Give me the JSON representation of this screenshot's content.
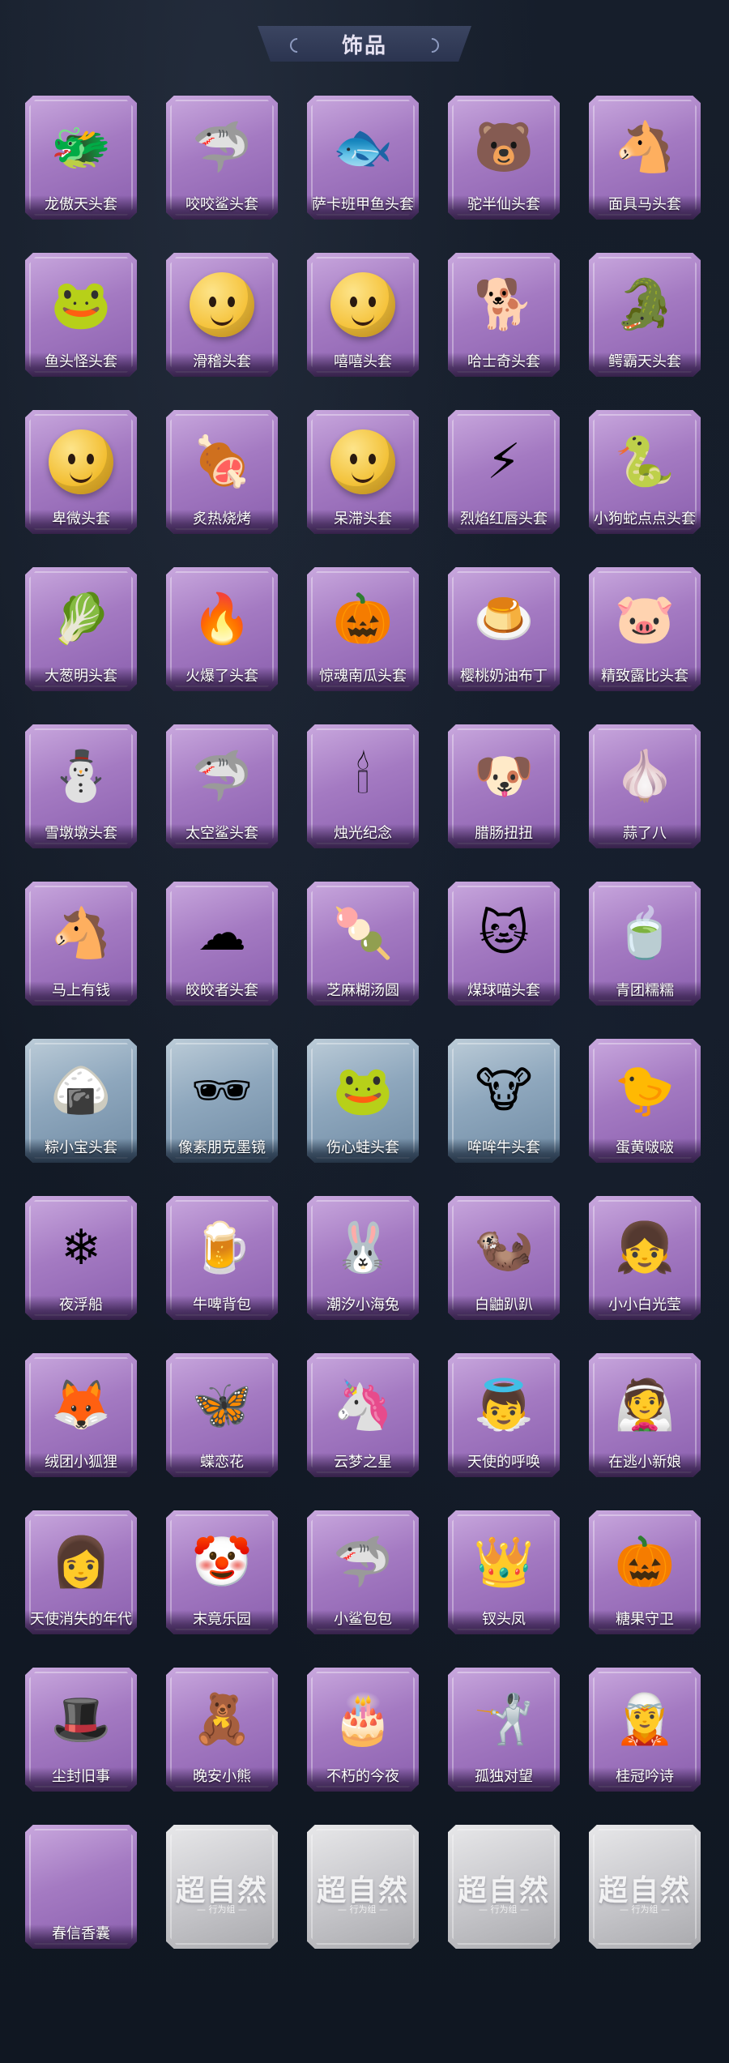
{
  "header": {
    "title": "饰品"
  },
  "items": [
    {
      "label": "龙傲天头套",
      "icon": "dragon-mask",
      "glyph": "🐲",
      "style": "purple"
    },
    {
      "label": "咬咬鲨头套",
      "icon": "shark-mask",
      "glyph": "🦈",
      "style": "purple"
    },
    {
      "label": "萨卡班甲鱼头套",
      "icon": "fish-mask",
      "glyph": "🐟",
      "style": "purple"
    },
    {
      "label": "驼半仙头套",
      "icon": "bear-sunglasses-mask",
      "glyph": "🐻",
      "style": "purple"
    },
    {
      "label": "面具马头套",
      "icon": "horse-mask",
      "glyph": "🐴",
      "style": "purple"
    },
    {
      "label": "鱼头怪头套",
      "icon": "fish-head-mask",
      "glyph": "🐸",
      "style": "purple"
    },
    {
      "label": "滑稽头套",
      "icon": "smirk-face-mask",
      "glyph": "",
      "ball": "#f5c23a",
      "style": "purple"
    },
    {
      "label": "嘻嘻头套",
      "icon": "grin-face-mask",
      "glyph": "",
      "ball": "#f5c23a",
      "style": "purple"
    },
    {
      "label": "哈士奇头套",
      "icon": "dog-sunglasses-mask",
      "glyph": "🐕",
      "style": "purple"
    },
    {
      "label": "鳄霸天头套",
      "icon": "crocodile-mask",
      "glyph": "🐊",
      "style": "purple"
    },
    {
      "label": "卑微头套",
      "icon": "sad-face-mask",
      "glyph": "",
      "ball": "#f2bd2f",
      "style": "purple"
    },
    {
      "label": "炙热烧烤",
      "icon": "grilled-meat-mask",
      "glyph": "🍖",
      "style": "purple"
    },
    {
      "label": "呆滞头套",
      "icon": "stare-face-mask",
      "glyph": "",
      "ball": "#f2c035",
      "style": "purple"
    },
    {
      "label": "烈焰红唇头套",
      "icon": "pikachu-mask",
      "glyph": "⚡",
      "style": "purple"
    },
    {
      "label": "小狗蛇点点头套",
      "icon": "snake-mask",
      "glyph": "🐍",
      "style": "purple"
    },
    {
      "label": "大葱明头套",
      "icon": "scallion-mask",
      "glyph": "🥬",
      "style": "purple"
    },
    {
      "label": "火爆了头套",
      "icon": "fire-mask",
      "glyph": "🔥",
      "style": "purple"
    },
    {
      "label": "惊魂南瓜头套",
      "icon": "pumpkin-mask",
      "glyph": "🎃",
      "style": "purple"
    },
    {
      "label": "樱桃奶油布丁",
      "icon": "pudding-mask",
      "glyph": "🍮",
      "style": "purple"
    },
    {
      "label": "精致露比头套",
      "icon": "pink-creature-mask",
      "glyph": "🐷",
      "style": "purple"
    },
    {
      "label": "雪墩墩头套",
      "icon": "snowman-mask",
      "glyph": "⛄",
      "style": "purple"
    },
    {
      "label": "太空鲨头套",
      "icon": "space-shark-mask",
      "glyph": "🦈",
      "style": "purple"
    },
    {
      "label": "烛光纪念",
      "icon": "candle-mask",
      "glyph": "🕯",
      "style": "purple"
    },
    {
      "label": "腊肠扭扭",
      "icon": "sausage-dog-mask",
      "glyph": "🐶",
      "style": "purple"
    },
    {
      "label": "蒜了八",
      "icon": "garlic-mask",
      "glyph": "🧄",
      "style": "purple"
    },
    {
      "label": "马上有钱",
      "icon": "horse-plush",
      "glyph": "🐴",
      "style": "purple"
    },
    {
      "label": "皎皎者头套",
      "icon": "cloud-mask",
      "glyph": "☁",
      "style": "purple"
    },
    {
      "label": "芝麻糊汤圆",
      "icon": "dumpling-mask",
      "glyph": "🍡",
      "style": "purple"
    },
    {
      "label": "煤球喵头套",
      "icon": "black-cat-mask",
      "glyph": "🐱",
      "style": "purple"
    },
    {
      "label": "青团糯糯",
      "icon": "green-rice-ball-mask",
      "glyph": "🍵",
      "style": "purple"
    },
    {
      "label": "粽小宝头套",
      "icon": "zongzi-mask",
      "glyph": "🍙",
      "style": "blue"
    },
    {
      "label": "像素朋克墨镜",
      "icon": "pixel-sunglasses",
      "glyph": "🕶",
      "style": "blue"
    },
    {
      "label": "伤心蛙头套",
      "icon": "sad-frog-mask",
      "glyph": "🐸",
      "style": "blue"
    },
    {
      "label": "哞哞牛头套",
      "icon": "cow-mask",
      "glyph": "🐮",
      "style": "blue"
    },
    {
      "label": "蛋黄啵啵",
      "icon": "chick-plush",
      "glyph": "🐤",
      "style": "purple"
    },
    {
      "label": "夜浮船",
      "icon": "ice-crystal-charm",
      "glyph": "❄",
      "style": "purple"
    },
    {
      "label": "牛啤背包",
      "icon": "beer-barrel-backpack",
      "glyph": "🍺",
      "style": "purple"
    },
    {
      "label": "潮汐小海兔",
      "icon": "sea-bunny-charm",
      "glyph": "🐰",
      "style": "purple"
    },
    {
      "label": "白鼬趴趴",
      "icon": "ferret-charm",
      "glyph": "🦦",
      "style": "purple"
    },
    {
      "label": "小小白光莹",
      "icon": "doll-charm",
      "glyph": "👧",
      "style": "purple"
    },
    {
      "label": "绒团小狐狸",
      "icon": "fox-charm",
      "glyph": "🦊",
      "style": "purple"
    },
    {
      "label": "蝶恋花",
      "icon": "butterfly-charm",
      "glyph": "🦋",
      "style": "purple"
    },
    {
      "label": "云梦之星",
      "icon": "unicorn-charm",
      "glyph": "🦄",
      "style": "purple"
    },
    {
      "label": "天使的呼唤",
      "icon": "angel-charm",
      "glyph": "👼",
      "style": "purple"
    },
    {
      "label": "在逃小新娘",
      "icon": "red-veil-charm",
      "glyph": "👰",
      "style": "purple"
    },
    {
      "label": "天使消失的年代",
      "icon": "angel-girl-charm",
      "glyph": "👩",
      "style": "purple"
    },
    {
      "label": "末竟乐园",
      "icon": "jester-doll-charm",
      "glyph": "🤡",
      "style": "purple"
    },
    {
      "label": "小鲨包包",
      "icon": "shark-bag-charm",
      "glyph": "🦈",
      "style": "purple"
    },
    {
      "label": "钗头凤",
      "icon": "phoenix-crown-charm",
      "glyph": "👑",
      "style": "purple"
    },
    {
      "label": "糖果守卫",
      "icon": "pumpkin-guard-charm",
      "glyph": "🎃",
      "style": "purple"
    },
    {
      "label": "尘封旧事",
      "icon": "gentleman-doll-charm",
      "glyph": "🎩",
      "style": "purple"
    },
    {
      "label": "晚安小熊",
      "icon": "teddy-bear-charm",
      "glyph": "🧸",
      "style": "purple"
    },
    {
      "label": "不朽的今夜",
      "icon": "cat-cake-charm",
      "glyph": "🎂",
      "style": "purple"
    },
    {
      "label": "孤独对望",
      "icon": "knight-doll-charm",
      "glyph": "🤺",
      "style": "purple"
    },
    {
      "label": "桂冠吟诗",
      "icon": "poet-doll-charm",
      "glyph": "🧝",
      "style": "purple"
    },
    {
      "label": "春信香囊",
      "icon": "sachet-charm",
      "glyph": "",
      "style": "purple"
    },
    {
      "label": "",
      "icon": "locked-slot",
      "glyph": "",
      "style": "locked",
      "locked_text": "超自然",
      "locked_sub": "— 行为组 —"
    },
    {
      "label": "",
      "icon": "locked-slot",
      "glyph": "",
      "style": "locked",
      "locked_text": "超自然",
      "locked_sub": "— 行为组 —"
    },
    {
      "label": "",
      "icon": "locked-slot",
      "glyph": "",
      "style": "locked",
      "locked_text": "超自然",
      "locked_sub": "— 行为组 —"
    },
    {
      "label": "",
      "icon": "locked-slot",
      "glyph": "",
      "style": "locked",
      "locked_text": "超自然",
      "locked_sub": "— 行为组 —"
    }
  ]
}
